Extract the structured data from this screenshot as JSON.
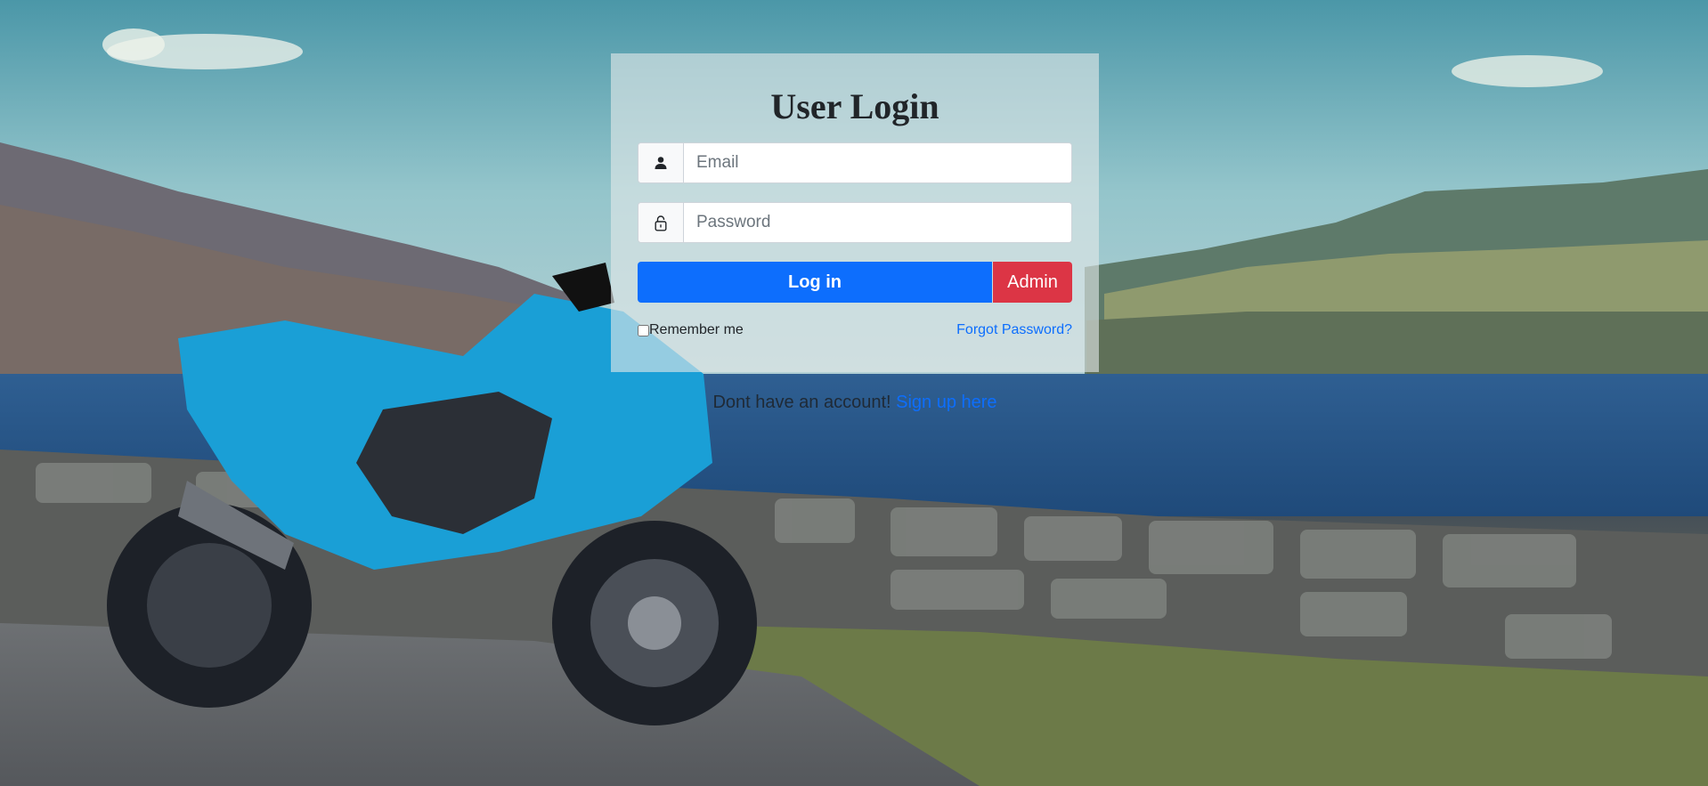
{
  "login": {
    "title": "User Login",
    "email_placeholder": "Email",
    "password_placeholder": "Password",
    "login_label": "Log in",
    "admin_label": "Admin",
    "remember_label": "Remember me",
    "forgot_label": "Forgot Password?",
    "signup_prompt": "Dont have an account! ",
    "signup_link": "Sign up here"
  },
  "colors": {
    "primary": "#0d6efd",
    "danger": "#dc3545",
    "panel": "#e2e8e9"
  },
  "icons": {
    "email_icon": "user-icon",
    "password_icon": "lock-icon"
  }
}
